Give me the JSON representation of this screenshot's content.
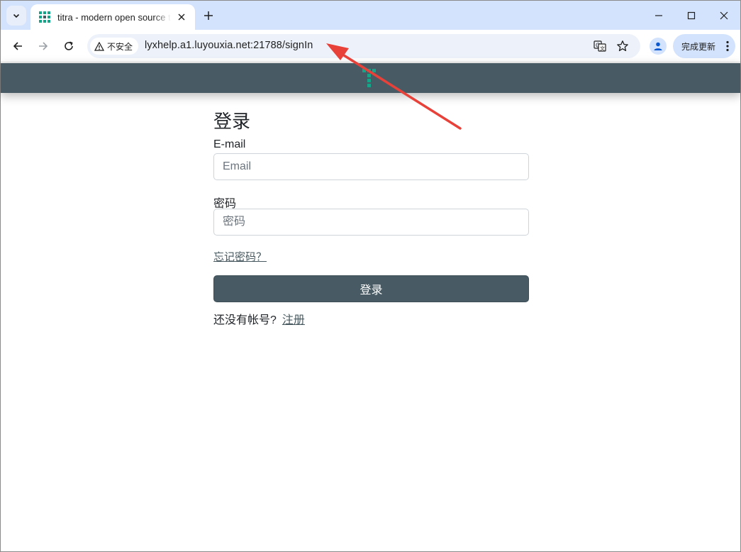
{
  "browser": {
    "tab_title": "titra - modern open source time tracking",
    "security_label": "不安全",
    "url": "lyxhelp.a1.luyouxia.net:21788/signIn",
    "update_button_label": "完成更新"
  },
  "colors": {
    "header_bg": "#485a63",
    "accent_teal": "#17a589",
    "annotation_arrow": "#e8413a"
  },
  "login": {
    "title": "登录",
    "email_label": "E-mail",
    "email_placeholder": "Email",
    "password_label": "密码",
    "password_placeholder": "密码",
    "forgot_password": "忘记密码？",
    "submit_label": "登录",
    "no_account_text": "还没有帐号?",
    "register_link": "注册"
  }
}
